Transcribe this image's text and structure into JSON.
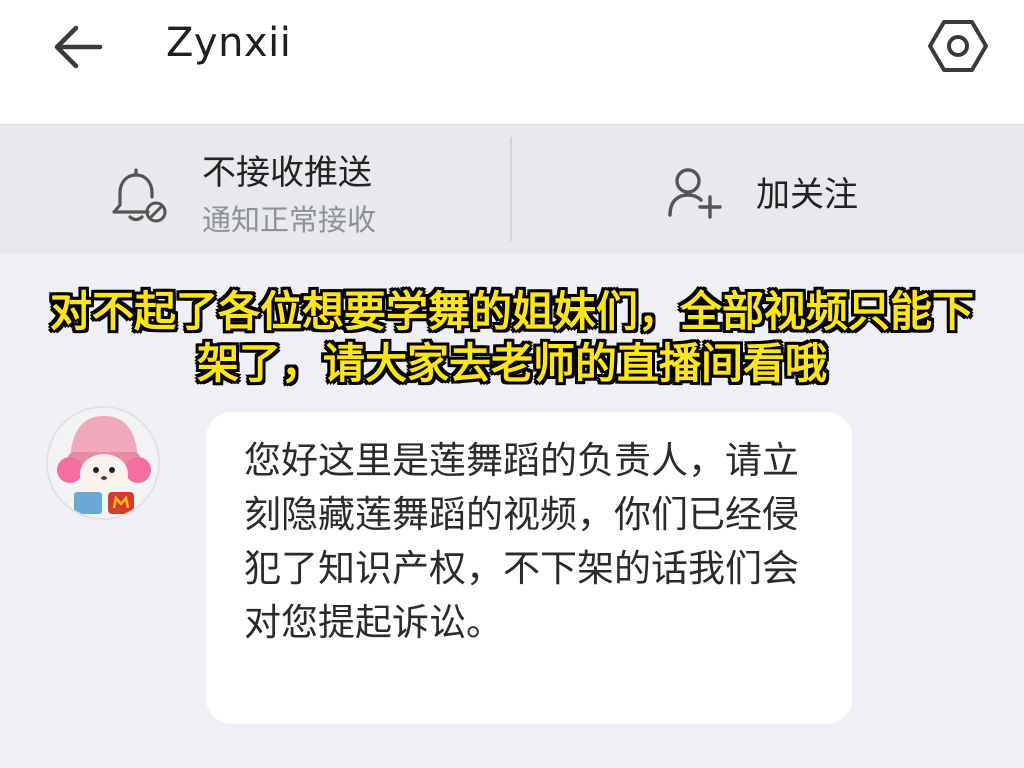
{
  "header": {
    "title": "Zynxii",
    "back_icon": "arrow-left-icon",
    "settings_icon": "hexagon-gear-icon"
  },
  "actions": {
    "push": {
      "icon": "bell-mute-icon",
      "title": "不接收推送",
      "subtitle": "通知正常接收"
    },
    "follow": {
      "icon": "add-user-icon",
      "label": "加关注"
    }
  },
  "message": {
    "avatar": "knitted-doll-avatar",
    "text": "您好这里是莲舞蹈的负责人，请立刻隐藏莲舞蹈的视频，你们已经侵犯了知识产权，不下架的话我们会对您提起诉讼。"
  },
  "overlay_caption": "对不起了各位想要学舞的姐妹们，全部视频只能下架了，请大家去老师的直播间看哦",
  "colors": {
    "caption_fill": "#ffe51a",
    "caption_outline": "#000000",
    "bubble": "#ffffff",
    "background": "#eef0f3"
  }
}
